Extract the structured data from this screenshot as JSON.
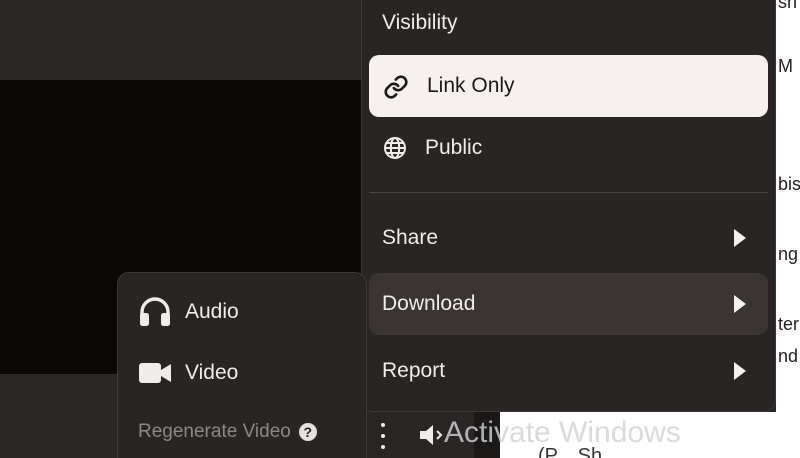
{
  "menu": {
    "visibility_label": "Visibility",
    "visibility_options": [
      {
        "label": "Link Only",
        "icon": "link-icon",
        "selected": true
      },
      {
        "label": "Public",
        "icon": "globe-icon",
        "selected": false
      }
    ],
    "items": [
      {
        "label": "Share",
        "icon": "chevron-right-icon"
      },
      {
        "label": "Download",
        "icon": "chevron-right-icon",
        "highlighted": true
      },
      {
        "label": "Report",
        "icon": "chevron-right-icon"
      }
    ]
  },
  "download_submenu": {
    "audio_label": "Audio",
    "video_label": "Video",
    "regenerate_label": "Regenerate Video",
    "help_glyph": "?"
  },
  "background_text": {
    "fragments": [
      "sh",
      "M",
      "bis",
      "ng",
      "ter",
      "nd"
    ],
    "bottom_partial": "(P... Sh..."
  },
  "watermark": "Activate Windows",
  "colors": {
    "menu_bg": "#292525",
    "selected_bg": "#f6f1ee",
    "hover_bg": "#3a3434",
    "text": "#f0ecea",
    "muted_text": "#8d8785"
  }
}
